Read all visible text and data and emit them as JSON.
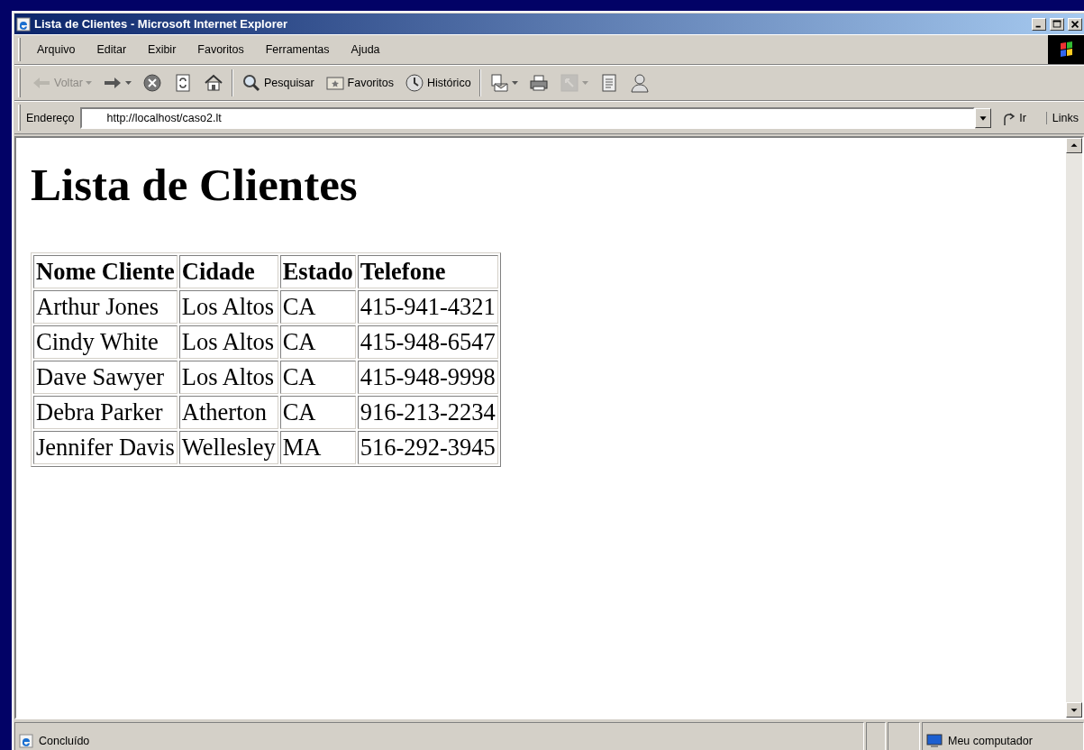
{
  "window": {
    "title": "Lista de Clientes - Microsoft Internet Explorer"
  },
  "menu": [
    "Arquivo",
    "Editar",
    "Exibir",
    "Favoritos",
    "Ferramentas",
    "Ajuda"
  ],
  "toolbar": [
    {
      "kind": "back",
      "label": "Voltar",
      "disabled": true,
      "dropdown": true
    },
    {
      "kind": "forward",
      "disabled": false,
      "dropdown": true
    },
    {
      "kind": "stop",
      "disabled": false
    },
    {
      "kind": "refresh",
      "disabled": false
    },
    {
      "kind": "home",
      "disabled": false
    },
    {
      "kind": "separator"
    },
    {
      "kind": "search",
      "label": "Pesquisar",
      "disabled": false
    },
    {
      "kind": "favorites",
      "label": "Favoritos",
      "disabled": false
    },
    {
      "kind": "history",
      "label": "Histórico",
      "disabled": false
    },
    {
      "kind": "separator"
    },
    {
      "kind": "mail",
      "disabled": false,
      "dropdown": true
    },
    {
      "kind": "print",
      "disabled": false
    },
    {
      "kind": "edit",
      "disabled": true,
      "dropdown": true
    },
    {
      "kind": "notes",
      "disabled": false
    },
    {
      "kind": "messenger",
      "disabled": false
    }
  ],
  "address": {
    "label": "Endereço",
    "value": "http://localhost/caso2.lt",
    "go": "Ir",
    "links": "Links"
  },
  "page": {
    "heading": "Lista de Clientes",
    "table": {
      "columns": [
        "Nome Cliente",
        "Cidade",
        "Estado",
        "Telefone"
      ],
      "rows": [
        [
          "Arthur Jones",
          "Los Altos",
          "CA",
          "415-941-4321"
        ],
        [
          "Cindy White",
          "Los Altos",
          "CA",
          "415-948-6547"
        ],
        [
          "Dave Sawyer",
          "Los Altos",
          "CA",
          "415-948-9998"
        ],
        [
          "Debra Parker",
          "Atherton",
          "CA",
          "916-213-2234"
        ],
        [
          "Jennifer Davis",
          "Wellesley",
          "MA",
          "516-292-3945"
        ]
      ]
    }
  },
  "status_bar": {
    "text": "Concluído",
    "zone": "Meu computador"
  }
}
